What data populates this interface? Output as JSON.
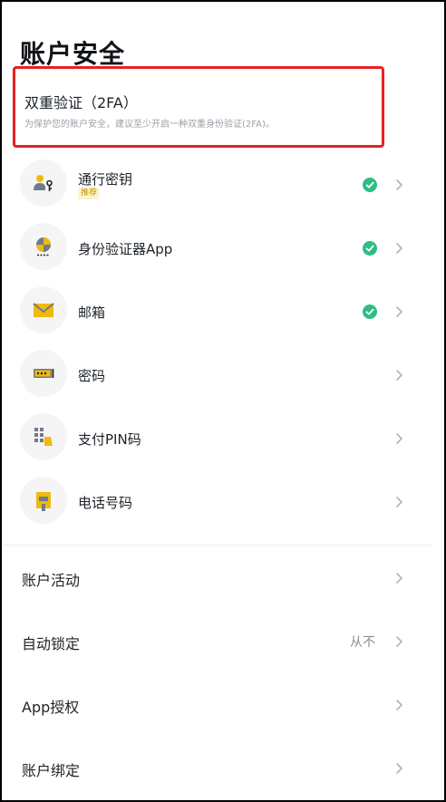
{
  "page_title": "账户安全",
  "twofa": {
    "title": "双重验证（2FA）",
    "description": "为保护您的账户安全，建议至少开启一种双重身份验证(2FA)。"
  },
  "methods": [
    {
      "label": "通行密钥",
      "badge": "推荐",
      "verified": true,
      "icon": "passkey-icon"
    },
    {
      "label": "身份验证器App",
      "verified": true,
      "icon": "authenticator-icon"
    },
    {
      "label": "邮箱",
      "verified": true,
      "icon": "email-icon"
    },
    {
      "label": "密码",
      "verified": false,
      "icon": "password-icon"
    },
    {
      "label": "支付PIN码",
      "verified": false,
      "icon": "pin-icon"
    },
    {
      "label": "电话号码",
      "verified": false,
      "icon": "phone-icon"
    }
  ],
  "settings": [
    {
      "label": "账户活动"
    },
    {
      "label": "自动锁定",
      "value": "从不"
    },
    {
      "label": "App授权"
    },
    {
      "label": "账户绑定"
    }
  ],
  "colors": {
    "brand_yellow": "#F0B90B",
    "verified_green": "#2EBD85",
    "highlight_red": "#E52222"
  }
}
